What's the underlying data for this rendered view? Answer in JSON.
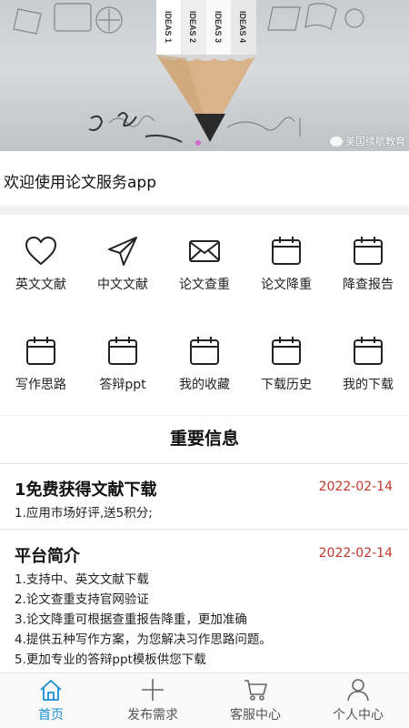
{
  "banner": {
    "pencil_labels": [
      "IDEAS 1",
      "IDEAS 2",
      "IDEAS 3",
      "IDEAS 4"
    ],
    "watermark": "美国续航教育"
  },
  "welcome": {
    "text": "欢迎使用论文服务app"
  },
  "grid": {
    "items": [
      {
        "label": "英文文献",
        "icon": "heart-icon"
      },
      {
        "label": "中文文献",
        "icon": "paper-plane-icon"
      },
      {
        "label": "论文查重",
        "icon": "envelope-icon"
      },
      {
        "label": "论文降重",
        "icon": "calendar-icon"
      },
      {
        "label": "降查报告",
        "icon": "calendar-icon"
      },
      {
        "label": "写作思路",
        "icon": "calendar-icon"
      },
      {
        "label": "答辩ppt",
        "icon": "calendar-icon"
      },
      {
        "label": "我的收藏",
        "icon": "calendar-icon"
      },
      {
        "label": "下载历史",
        "icon": "calendar-icon"
      },
      {
        "label": "我的下载",
        "icon": "calendar-icon"
      }
    ]
  },
  "info": {
    "title": "重要信息",
    "news": [
      {
        "title": "1免费获得文献下载",
        "date": "2022-02-14",
        "lines": [
          "1.应用市场好评,送5积分;"
        ]
      },
      {
        "title": "平台简介",
        "date": "2022-02-14",
        "lines": [
          "1.支持中、英文文献下载",
          "2.论文查重支持官网验证",
          "3.论文降重可根据查重报告降重，更加准确",
          "4.提供五种写作方案，为您解决习作思路问题。",
          "5.更加专业的答辩ppt模板供您下载"
        ]
      }
    ]
  },
  "tabbar": {
    "tabs": [
      {
        "label": "首页",
        "icon": "home-icon",
        "active": true
      },
      {
        "label": "发布需求",
        "icon": "plus-icon",
        "active": false
      },
      {
        "label": "客服中心",
        "icon": "cart-icon",
        "active": false
      },
      {
        "label": "个人中心",
        "icon": "person-icon",
        "active": false
      }
    ]
  },
  "colors": {
    "accent": "#1a8fd6",
    "date": "#c0392b"
  }
}
